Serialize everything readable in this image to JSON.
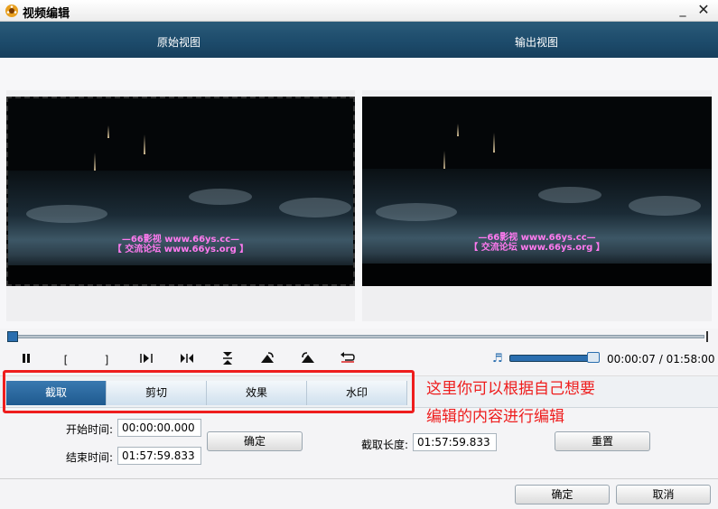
{
  "window": {
    "title": "视频编辑",
    "minimize_label": "_",
    "close_label": "✕"
  },
  "header": {
    "original_view": "原始视图",
    "output_view": "输出视图"
  },
  "video": {
    "watermark_line1": "—66影视 www.66ys.cc—",
    "watermark_line2": "【 交流论坛 www.66ys.org 】"
  },
  "controls": {
    "play_pause_icon": "pause-icon",
    "mark_in": "[",
    "mark_out": "]",
    "time": "00:00:07 / 01:58:00",
    "volume_level": 0.85
  },
  "tabs": [
    {
      "label": "截取",
      "active": true
    },
    {
      "label": "剪切",
      "active": false
    },
    {
      "label": "效果",
      "active": false
    },
    {
      "label": "水印",
      "active": false
    }
  ],
  "annotation": {
    "line1": "这里你可以根据自己想要",
    "line2": "编辑的内容进行编辑",
    "color": "#ee1d1d"
  },
  "trim": {
    "start_label": "开始时间:",
    "start_value": "00:00:00.000",
    "end_label": "结束时间:",
    "end_value": "01:57:59.833",
    "confirm_label": "确定",
    "length_label": "截取长度:",
    "length_value": "01:57:59.833",
    "reset_label": "重置"
  },
  "footer": {
    "ok_label": "确定",
    "cancel_label": "取消"
  },
  "colors": {
    "header_bg": "#1c4a6a",
    "accent": "#2a6eaf",
    "active_tab": "#2a6eaf"
  }
}
